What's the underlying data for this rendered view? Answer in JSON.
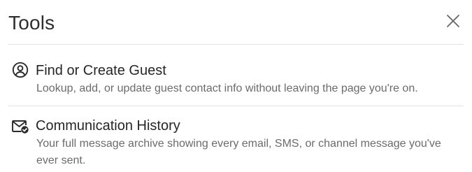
{
  "header": {
    "title": "Tools",
    "close_icon": "close-icon"
  },
  "tools": [
    {
      "icon": "user-circle-icon",
      "name": "Find or Create Guest",
      "description": "Lookup, add, or update guest contact info without leaving the page you're on."
    },
    {
      "icon": "envelope-check-icon",
      "name": "Communication History",
      "description": "Your full message archive showing every email, SMS, or channel message you've ever sent."
    }
  ],
  "colors": {
    "title": "#2e2e2e",
    "item_name": "#262626",
    "description": "#6b6b6b",
    "divider": "#e3e3e3",
    "icon": "#2b2b2b"
  }
}
